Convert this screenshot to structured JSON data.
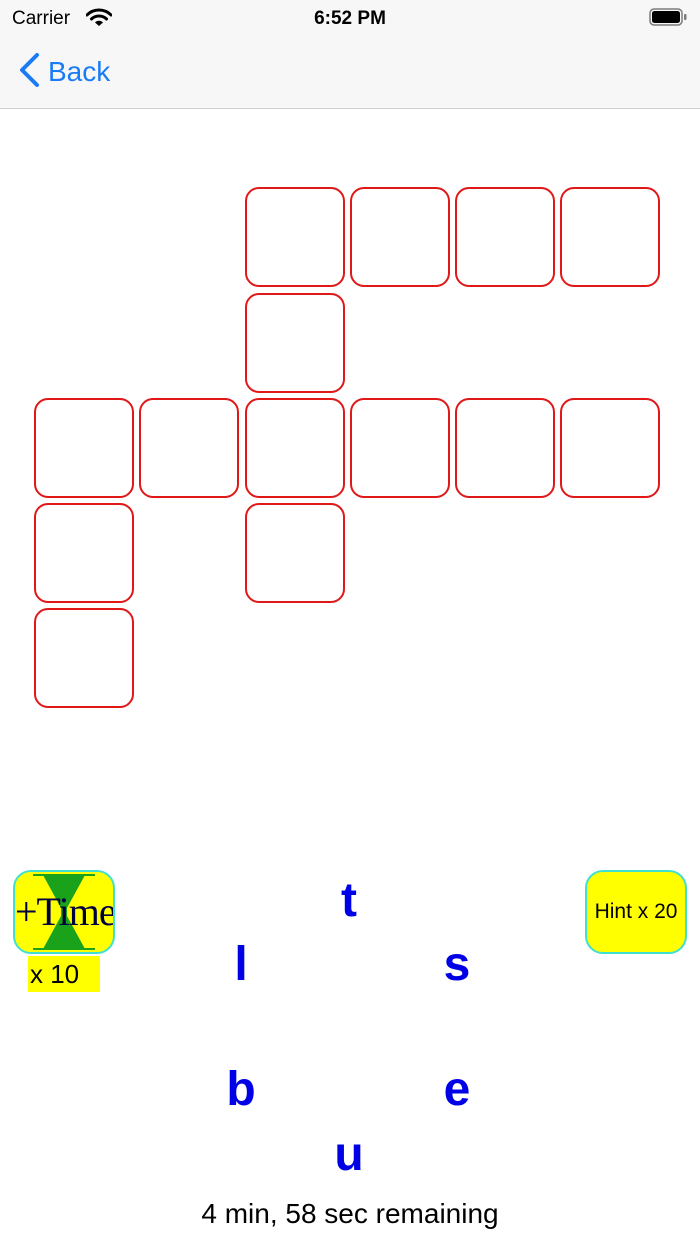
{
  "status_bar": {
    "carrier": "Carrier",
    "time": "6:52 PM",
    "wifi_icon": "wifi-icon",
    "battery_icon": "battery-icon"
  },
  "nav": {
    "back_label": "Back",
    "back_icon": "chevron-left-icon"
  },
  "board": {
    "cell_color": "#e01818",
    "rows": [
      [
        "",
        "",
        "",
        "",
        "",
        ""
      ],
      [
        "",
        "",
        "",
        "",
        "",
        ""
      ],
      [
        "",
        "",
        "",
        "",
        "",
        ""
      ],
      [
        "",
        "",
        "",
        "",
        "",
        ""
      ],
      [
        "",
        "",
        "",
        "",
        "",
        ""
      ]
    ]
  },
  "powerups": {
    "time": {
      "label": "+Time",
      "count": "x 10",
      "icon": "hourglass-icon"
    },
    "hint": {
      "label": "Hint x 20"
    },
    "button_color": "#ffff00",
    "border_color": "#3fe0d0"
  },
  "letter_wheel": {
    "color": "#0000e6",
    "letters": [
      "t",
      "s",
      "e",
      "u",
      "b",
      "l"
    ]
  },
  "timer": {
    "text": "4 min, 58 sec remaining"
  }
}
